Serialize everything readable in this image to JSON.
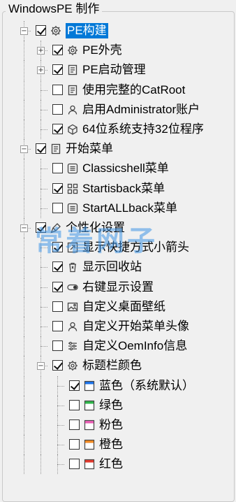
{
  "group_title": "WindowsPE 制作",
  "nodes": [
    {
      "label": "PE构建",
      "checked": true,
      "selected": true,
      "icon": "gear-icon",
      "expander": "minus"
    },
    {
      "label": "PE外壳",
      "checked": true,
      "icon": "gear-icon",
      "expander": "plus"
    },
    {
      "label": "PE启动管理",
      "checked": true,
      "icon": "document-icon",
      "expander": "plus"
    },
    {
      "label": "使用完整的CatRoot",
      "checked": false,
      "icon": "document-icon"
    },
    {
      "label": "启用Administrator账户",
      "checked": false,
      "icon": "user-icon"
    },
    {
      "label": "64位系统支持32位程序",
      "checked": true,
      "icon": "cube-icon"
    },
    {
      "label": "开始菜单",
      "checked": true,
      "icon": "document-icon",
      "expander": "minus"
    },
    {
      "label": "Classicshell菜单",
      "checked": false,
      "icon": "list-icon"
    },
    {
      "label": "Startisback菜单",
      "checked": true,
      "icon": "grid-icon"
    },
    {
      "label": "StartALLback菜单",
      "checked": false,
      "icon": "list-icon"
    },
    {
      "label": "个性化设置",
      "checked": true,
      "icon": "brush-icon",
      "expander": "minus"
    },
    {
      "label": "显示快捷方式小箭头",
      "checked": true,
      "icon": "shortcut-arrow-icon"
    },
    {
      "label": "显示回收站",
      "checked": true,
      "icon": "recycle-bin-icon"
    },
    {
      "label": "右键显示设置",
      "checked": true,
      "icon": "toggle-icon"
    },
    {
      "label": "自定义桌面壁纸",
      "checked": false,
      "icon": "image-icon"
    },
    {
      "label": "自定义开始菜单头像",
      "checked": false,
      "icon": "user-icon"
    },
    {
      "label": "自定义OemInfo信息",
      "checked": false,
      "icon": "sliders-icon"
    },
    {
      "label": "标题栏颜色",
      "checked": true,
      "icon": "gear-icon",
      "expander": "minus"
    },
    {
      "label": "蓝色（系统默认）",
      "checked": true,
      "icon": "window-color-icon",
      "color": "#1e73e8"
    },
    {
      "label": "绿色",
      "checked": false,
      "icon": "window-color-icon",
      "color": "#2fb54a"
    },
    {
      "label": "粉色",
      "checked": false,
      "icon": "window-color-icon",
      "color": "#e85fb4"
    },
    {
      "label": "橙色",
      "checked": false,
      "icon": "window-color-icon",
      "color": "#f08a24"
    },
    {
      "label": "红色",
      "checked": false,
      "icon": "window-color-icon",
      "color": "#e23a2e"
    }
  ],
  "watermark": "常着网子"
}
